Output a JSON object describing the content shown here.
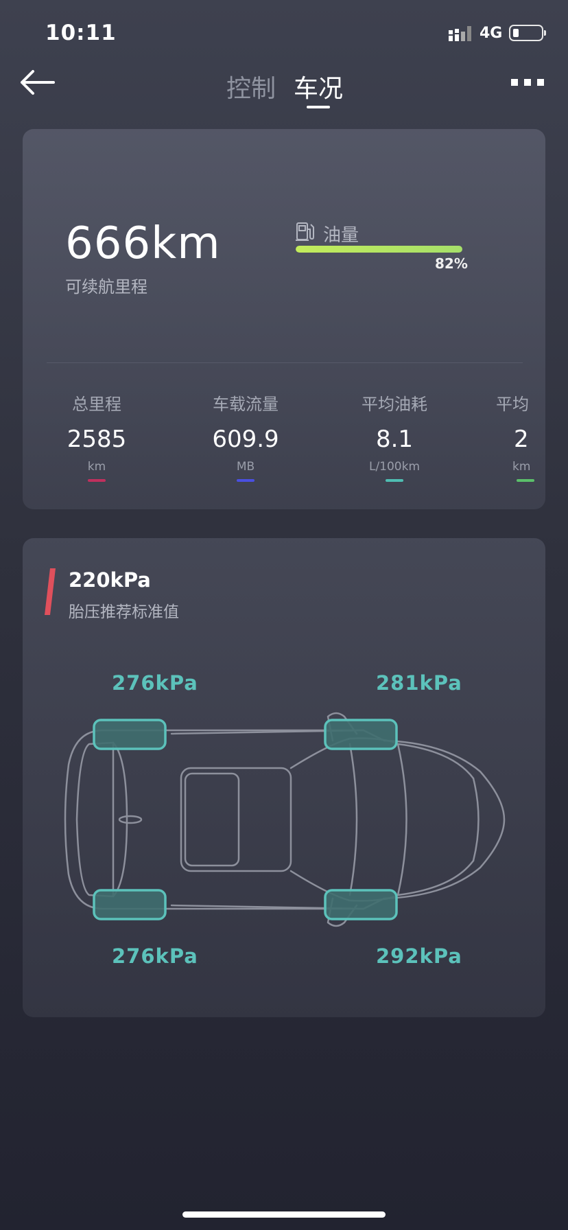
{
  "status_bar": {
    "time": "10:11",
    "network": "4G"
  },
  "nav": {
    "tabs": [
      {
        "label": "控制"
      },
      {
        "label": "车况"
      }
    ],
    "active_tab": "车况"
  },
  "range": {
    "value": "666km",
    "label": "可续航里程"
  },
  "fuel": {
    "label": "油量",
    "percent": 82,
    "percent_text": "82%"
  },
  "stats": [
    {
      "label": "总里程",
      "value": "2585",
      "unit": "km",
      "color": "#c0305d"
    },
    {
      "label": "车载流量",
      "value": "609.9",
      "unit": "MB",
      "color": "#4a4fe0"
    },
    {
      "label": "平均油耗",
      "value": "8.1",
      "unit": "L/100km",
      "color": "#4fbdb2"
    },
    {
      "label": "平均",
      "value": "2",
      "unit": "km",
      "color": "#5bbf6a"
    }
  ],
  "tire_pressure": {
    "recommended_value": "220kPa",
    "recommended_label": "胎压推荐标准值",
    "accent_color": "#e0505c",
    "front_left": "276kPa",
    "front_right": "281kPa",
    "rear_left": "276kPa",
    "rear_right": "292kPa"
  }
}
